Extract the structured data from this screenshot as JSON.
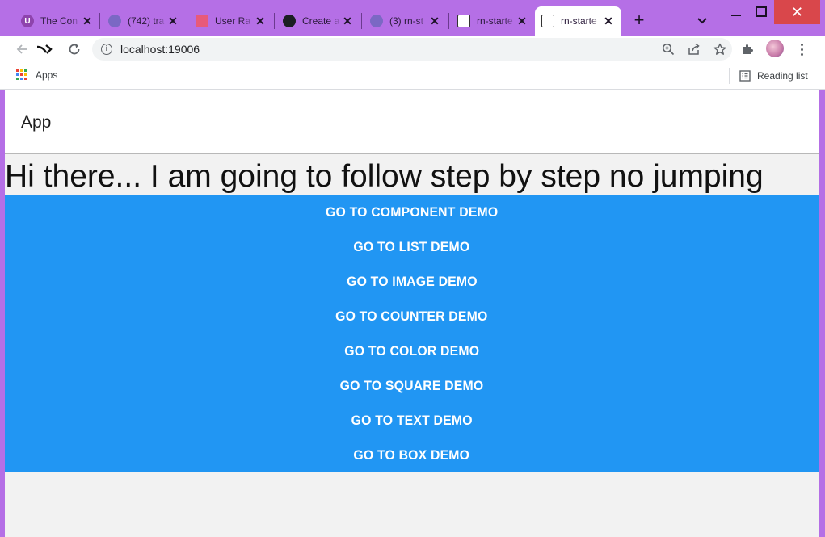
{
  "browser": {
    "tabs": [
      {
        "title": "The Con",
        "favicon_color": "#8e44ad",
        "favicon_glyph": "U"
      },
      {
        "title": "(742) tra",
        "favicon_color": "#7b68c4",
        "favicon_glyph": ""
      },
      {
        "title": "User Ra",
        "favicon_color": "#e85a7a",
        "favicon_glyph": ""
      },
      {
        "title": "Create a",
        "favicon_color": "#1b1f23",
        "favicon_glyph": ""
      },
      {
        "title": "(3) rn-st",
        "favicon_color": "#7b68c4",
        "favicon_glyph": ""
      },
      {
        "title": "rn-starte",
        "favicon_color": "#333333",
        "favicon_glyph": ""
      },
      {
        "title": "rn-starte",
        "favicon_color": "#333333",
        "favicon_glyph": "",
        "active": true
      }
    ],
    "url": "localhost:19006",
    "bookmarks": {
      "apps_label": "Apps",
      "reading_list_label": "Reading list"
    },
    "accent_color": "#b56fe6"
  },
  "app": {
    "header_title": "App",
    "greeting": "Hi there... I am going to follow step by step no jumping",
    "button_color": "#2196f3",
    "buttons": [
      {
        "label": "GO TO COMPONENT DEMO"
      },
      {
        "label": "GO TO LIST DEMO"
      },
      {
        "label": "GO TO IMAGE DEMO"
      },
      {
        "label": "GO TO COUNTER DEMO"
      },
      {
        "label": "GO TO COLOR DEMO"
      },
      {
        "label": "GO TO SQUARE DEMO"
      },
      {
        "label": "GO TO TEXT DEMO"
      },
      {
        "label": "GO TO BOX DEMO"
      }
    ]
  }
}
